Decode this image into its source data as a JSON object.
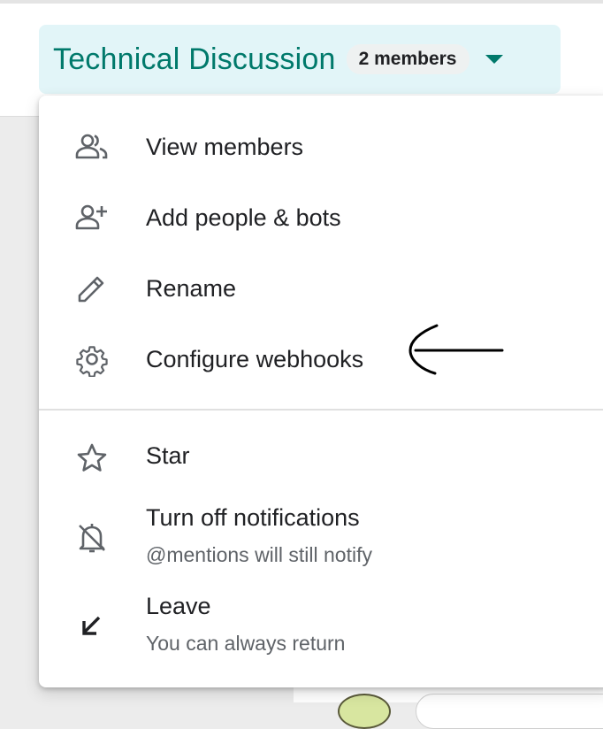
{
  "header": {
    "room_title": "Technical Discussion",
    "members_badge": "2 members",
    "accent_color": "#00796b",
    "chip_background": "#e2f5f8"
  },
  "menu": {
    "items": [
      {
        "label": "View members",
        "icon": "people-icon"
      },
      {
        "label": "Add people & bots",
        "icon": "person-add-icon"
      },
      {
        "label": "Rename",
        "icon": "pencil-icon"
      },
      {
        "label": "Configure webhooks",
        "icon": "gear-icon"
      },
      {
        "label": "Star",
        "icon": "star-icon"
      },
      {
        "label": "Turn off notifications",
        "sublabel": "@mentions will still notify",
        "icon": "bell-off-icon"
      },
      {
        "label": "Leave",
        "sublabel": "You can always return",
        "icon": "leave-arrow-icon"
      }
    ]
  },
  "annotation": {
    "icon": "hand-drawn-left-arrow-icon",
    "color": "#000000"
  }
}
